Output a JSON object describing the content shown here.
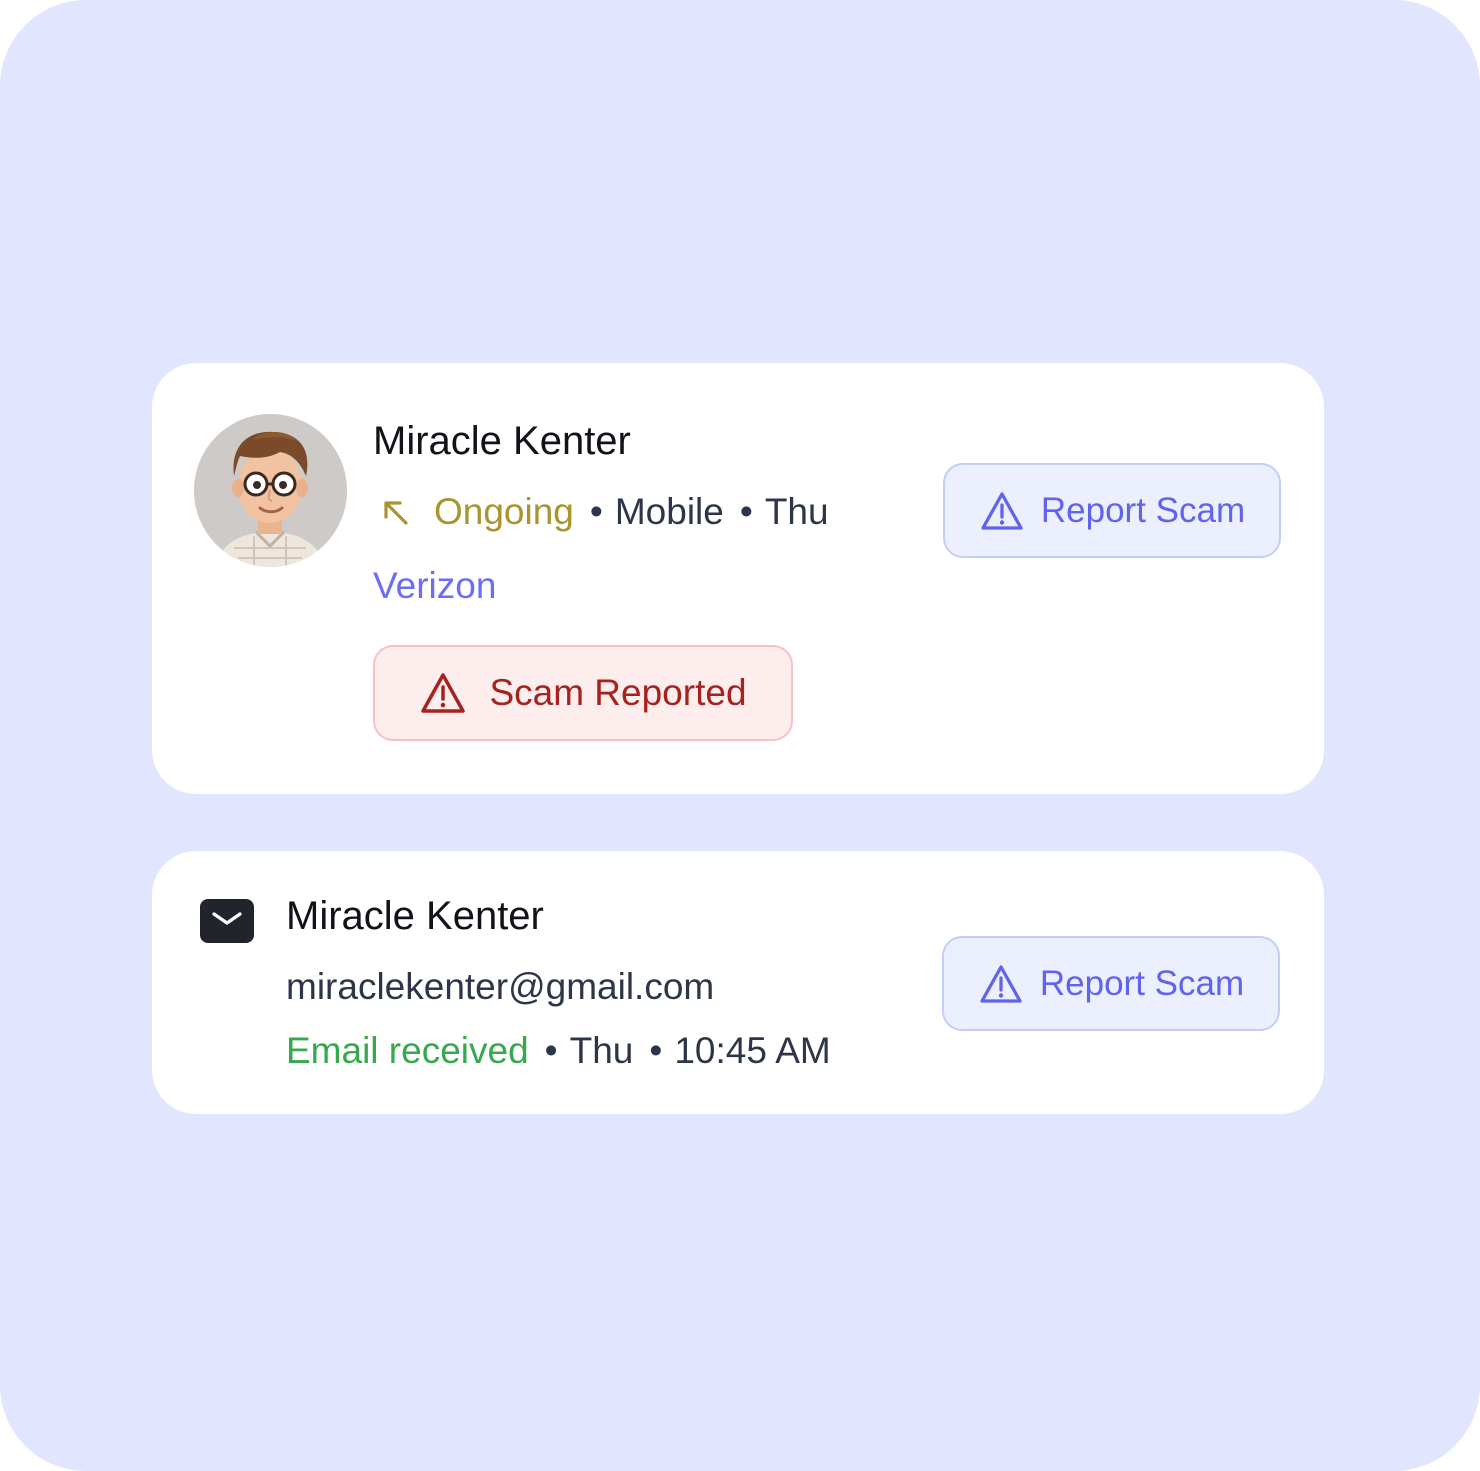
{
  "call_card": {
    "contact_name": "Miracle Kenter",
    "call_status": "Ongoing",
    "separator": "•",
    "device": "Mobile",
    "day": "Thu",
    "carrier": "Verizon",
    "scam_reported_label": "Scam Reported",
    "report_button_label": "Report Scam",
    "status_color": "#a8952f"
  },
  "email_card": {
    "contact_name": "Miracle Kenter",
    "email_address": "miraclekenter@gmail.com",
    "email_status": "Email received",
    "separator": "•",
    "day": "Thu",
    "time": "10:45 AM",
    "report_button_label": "Report Scam",
    "status_color": "#37a84e"
  },
  "icons": {
    "call": "outgoing-arrow-icon",
    "warning": "warning-triangle-icon",
    "mail": "mail-icon",
    "avatar": "avatar-illustration"
  },
  "colors": {
    "background": "#e1e5fd",
    "accent": "#6063ee",
    "danger": "#a5221f",
    "danger_bg": "#fdeded"
  }
}
